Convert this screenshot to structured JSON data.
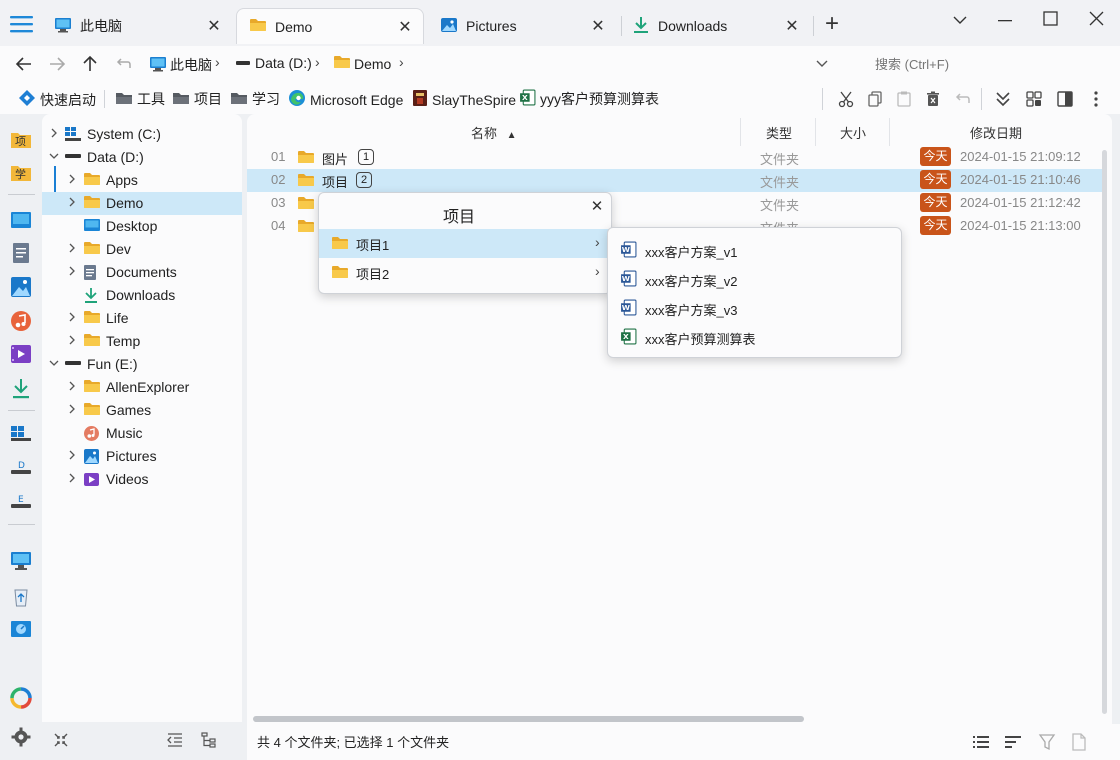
{
  "tabs": [
    {
      "label": "此电脑",
      "icon": "monitor-icon",
      "active": false
    },
    {
      "label": "Demo",
      "icon": "folder-icon",
      "active": true
    },
    {
      "label": "Pictures",
      "icon": "pictures-icon",
      "active": false
    },
    {
      "label": "Downloads",
      "icon": "download-icon",
      "active": false
    }
  ],
  "breadcrumb": [
    "此电脑",
    "Data (D:)",
    "Demo"
  ],
  "search": {
    "placeholder": "搜索 (Ctrl+F)"
  },
  "bookmarks": [
    {
      "label": "快速启动",
      "icon": "quick-launch-icon"
    },
    {
      "label": "工具",
      "icon": "folder-dark-icon"
    },
    {
      "label": "项目",
      "icon": "folder-dark-icon"
    },
    {
      "label": "学习",
      "icon": "folder-dark-icon"
    },
    {
      "label": "Microsoft Edge",
      "icon": "edge-icon"
    },
    {
      "label": "SlayTheSpire",
      "icon": "game-icon"
    },
    {
      "label": "yyy客户预算测算表",
      "icon": "excel-icon"
    }
  ],
  "rail": {
    "labels": [
      "项",
      "学"
    ]
  },
  "tree": [
    {
      "label": "System (C:)",
      "type": "drive-win",
      "expander": "collapsed"
    },
    {
      "label": "Data (D:)",
      "type": "drive",
      "expander": "expanded"
    },
    {
      "label": "Apps",
      "type": "folder",
      "expander": "collapsed"
    },
    {
      "label": "Demo",
      "type": "folder",
      "expander": "collapsed",
      "selected": true
    },
    {
      "label": "Desktop",
      "type": "desktop",
      "expander": "none"
    },
    {
      "label": "Dev",
      "type": "folder",
      "expander": "collapsed"
    },
    {
      "label": "Documents",
      "type": "documents",
      "expander": "collapsed"
    },
    {
      "label": "Downloads",
      "type": "downloads",
      "expander": "none"
    },
    {
      "label": "Life",
      "type": "folder",
      "expander": "collapsed"
    },
    {
      "label": "Temp",
      "type": "folder",
      "expander": "collapsed"
    },
    {
      "label": "Fun (E:)",
      "type": "drive",
      "expander": "expanded"
    },
    {
      "label": "AllenExplorer",
      "type": "folder",
      "expander": "collapsed"
    },
    {
      "label": "Games",
      "type": "folder",
      "expander": "collapsed"
    },
    {
      "label": "Music",
      "type": "music",
      "expander": "none"
    },
    {
      "label": "Pictures",
      "type": "pictures",
      "expander": "collapsed"
    },
    {
      "label": "Videos",
      "type": "videos",
      "expander": "collapsed"
    }
  ],
  "columns": {
    "name": "名称",
    "type": "类型",
    "size": "大小",
    "modified": "修改日期"
  },
  "rows": [
    {
      "num": "01",
      "name": "图片",
      "count": "1",
      "type": "文件夹",
      "badge": "今天",
      "date": "2024-01-15  21:09:12",
      "selected": false
    },
    {
      "num": "02",
      "name": "项目",
      "count": "2",
      "type": "文件夹",
      "badge": "今天",
      "date": "2024-01-15  21:10:46",
      "selected": true
    },
    {
      "num": "03",
      "name": "",
      "count": "",
      "type": "文件夹",
      "badge": "今天",
      "date": "2024-01-15  21:12:42",
      "selected": false
    },
    {
      "num": "04",
      "name": "",
      "count": "",
      "type": "文件夹",
      "badge": "今天",
      "date": "2024-01-15  21:13:00",
      "selected": false
    }
  ],
  "popup": {
    "title": "项目",
    "items": [
      {
        "label": "项目1",
        "highlighted": true
      },
      {
        "label": "项目2",
        "highlighted": false
      }
    ]
  },
  "submenu": {
    "items": [
      {
        "label": "xxx客户方案_v1",
        "icon": "word-icon"
      },
      {
        "label": "xxx客户方案_v2",
        "icon": "word-icon"
      },
      {
        "label": "xxx客户方案_v3",
        "icon": "word-icon"
      },
      {
        "label": "xxx客户预算测算表",
        "icon": "excel-icon"
      }
    ]
  },
  "status": {
    "text": "共 4 个文件夹; 已选择 1 个文件夹"
  },
  "colors": {
    "accent": "#0078d4",
    "selection": "#cde8f8",
    "badge": "#c9541a",
    "folder": "#f5c443"
  }
}
